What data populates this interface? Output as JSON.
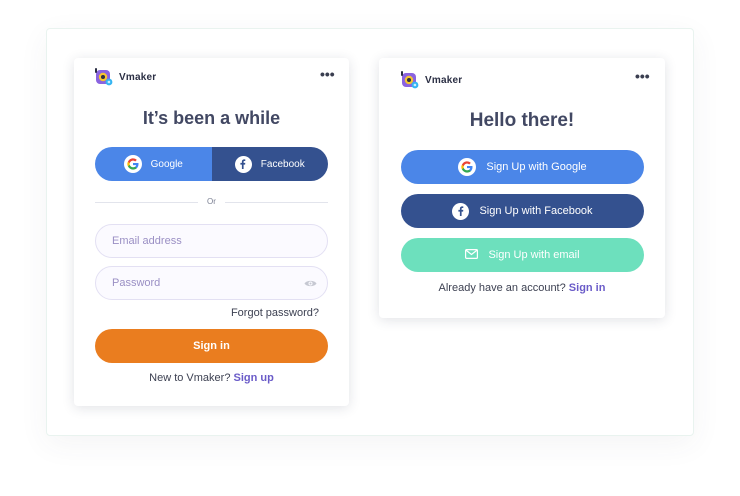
{
  "brand": {
    "name": "Vmaker"
  },
  "login_card": {
    "title": "It’s been a while",
    "google_label": "Google",
    "facebook_label": "Facebook",
    "divider_text": "Or",
    "email_placeholder": "Email address",
    "password_placeholder": "Password",
    "forgot_label": "Forgot password?",
    "signin_label": "Sign in",
    "new_prefix": "New to Vmaker?",
    "signup_link": "Sign up"
  },
  "signup_card": {
    "title": "Hello there!",
    "google_label": "Sign Up with Google",
    "facebook_label": "Sign Up with Facebook",
    "email_label": "Sign Up with email",
    "already_prefix": "Already have an account?",
    "signin_link": "Sign in"
  },
  "more_icon": "•••",
  "colors": {
    "google_blue": "#4b86e8",
    "facebook_blue": "#34518f",
    "email_green": "#6de0bd",
    "signin_orange": "#ea7d1f",
    "link_purple": "#6a5bc8"
  }
}
